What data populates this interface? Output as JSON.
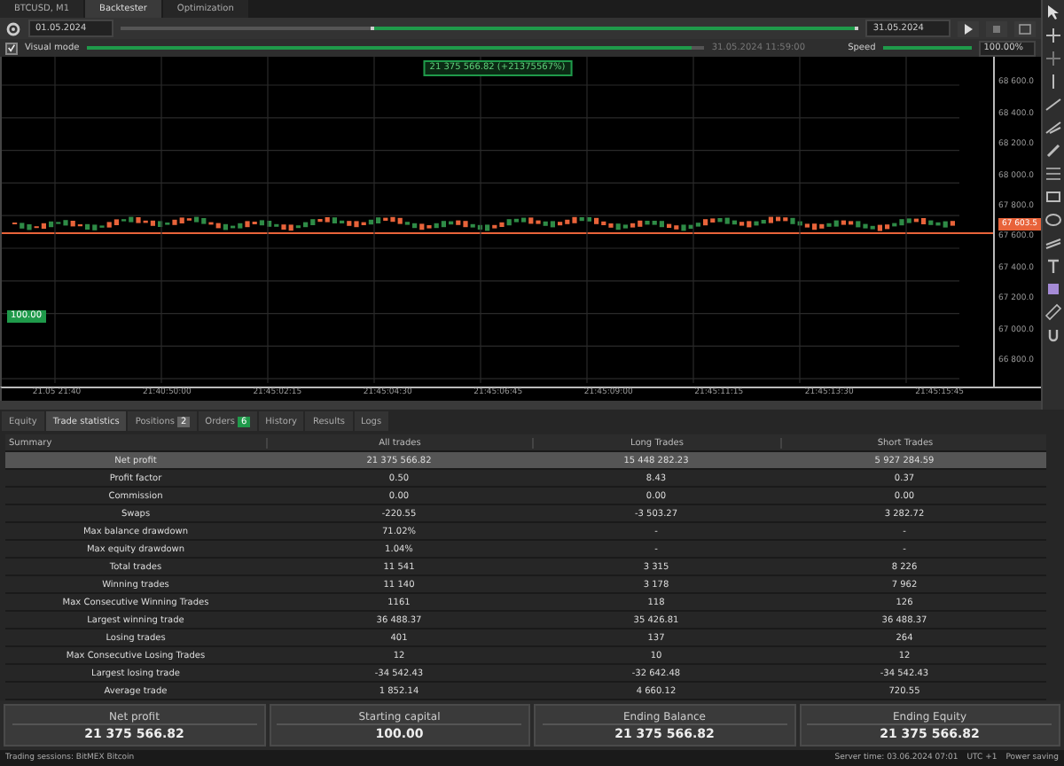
{
  "tabs": [
    {
      "label": "BTCUSD, M1",
      "selected": false
    },
    {
      "label": "Backtester",
      "selected": true
    },
    {
      "label": "Optimization",
      "selected": false
    }
  ],
  "toolbar": {
    "start_date": "01.05.2024",
    "end_date": "31.05.2024",
    "range": {
      "level": 0.66
    }
  },
  "visual": {
    "label": "Visual mode",
    "checked": true,
    "progress": {
      "level": 0.98
    },
    "time": "31.05.2024 11:59:00",
    "speed_label": "Speed",
    "speed": "100.00%",
    "speed_slider": {
      "level": 1.0
    }
  },
  "chart": {
    "result_label": "21 375 566.82 (+21375567%)",
    "price_tag": "67 603.5",
    "left_tag": "100.00",
    "price_axis": [
      "68 600.0",
      "68 400.0",
      "68 200.0",
      "68 000.0",
      "67 800.0",
      "67 600.0",
      "67 400.0",
      "67 200.0",
      "67 000.0",
      "66 800.0"
    ],
    "time_axis": [
      "21.05 21:40",
      "21:40:50:00",
      "21:45:02:15",
      "21:45:04:30",
      "21:45:06:45",
      "21:45:09:00",
      "21:45:11:15",
      "21:45:13:30",
      "21:45:15:45"
    ]
  },
  "bottom_tabs": [
    {
      "label": "Equity",
      "selected": false
    },
    {
      "label": "Trade statistics",
      "selected": true
    },
    {
      "label": "Positions",
      "badge": "2",
      "color": "#666666",
      "selected": false
    },
    {
      "label": "Orders",
      "badge": "6",
      "color": "#1f9a4a",
      "selected": false
    },
    {
      "label": "History",
      "selected": false
    },
    {
      "label": "Results",
      "selected": false
    },
    {
      "label": "Logs",
      "selected": false
    }
  ],
  "table": {
    "columns": [
      "Summary",
      "All trades",
      "Long Trades",
      "Short Trades"
    ],
    "rows": [
      {
        "cells": [
          "Net profit",
          "21 375 566.82",
          "15 448 282.23",
          "5 927 284.59"
        ],
        "selected": true
      },
      {
        "cells": [
          "Profit factor",
          "0.50",
          "8.43",
          "0.37"
        ],
        "selected": false
      },
      {
        "cells": [
          "Commission",
          "0.00",
          "0.00",
          "0.00"
        ],
        "selected": false
      },
      {
        "cells": [
          "Swaps",
          "-220.55",
          "-3 503.27",
          "3 282.72"
        ],
        "selected": false
      },
      {
        "cells": [
          "Max balance drawdown",
          "71.02%",
          "-",
          "-"
        ],
        "selected": false
      },
      {
        "cells": [
          "Max equity drawdown",
          "1.04%",
          "-",
          "-"
        ],
        "selected": false
      },
      {
        "cells": [
          "Total trades",
          "11 541",
          "3 315",
          "8 226"
        ],
        "selected": false
      },
      {
        "cells": [
          "Winning trades",
          "11 140",
          "3 178",
          "7 962"
        ],
        "selected": false
      },
      {
        "cells": [
          "Max Consecutive Winning Trades",
          "1161",
          "118",
          "126"
        ],
        "selected": false
      },
      {
        "cells": [
          "Largest winning trade",
          "36 488.37",
          "35 426.81",
          "36 488.37"
        ],
        "selected": false
      },
      {
        "cells": [
          "Losing trades",
          "401",
          "137",
          "264"
        ],
        "selected": false
      },
      {
        "cells": [
          "Max Consecutive Losing Trades",
          "12",
          "10",
          "12"
        ],
        "selected": false
      },
      {
        "cells": [
          "Largest losing trade",
          "-34 542.43",
          "-32 642.48",
          "-34 542.43"
        ],
        "selected": false
      },
      {
        "cells": [
          "Average trade",
          "1 852.14",
          "4 660.12",
          "720.55"
        ],
        "selected": false
      }
    ]
  },
  "summary": [
    {
      "label": "Net profit",
      "value": "21 375 566.82"
    },
    {
      "label": "Starting capital",
      "value": "100.00"
    },
    {
      "label": "Ending Balance",
      "value": "21 375 566.82"
    },
    {
      "label": "Ending Equity",
      "value": "21 375 566.82"
    }
  ],
  "status_bar": {
    "left": "Trading sessions: BitMEX Bitcoin",
    "server_time": "Server time: 03.06.2024 07:01",
    "timezone": "UTC +1",
    "mode": "Power saving"
  }
}
